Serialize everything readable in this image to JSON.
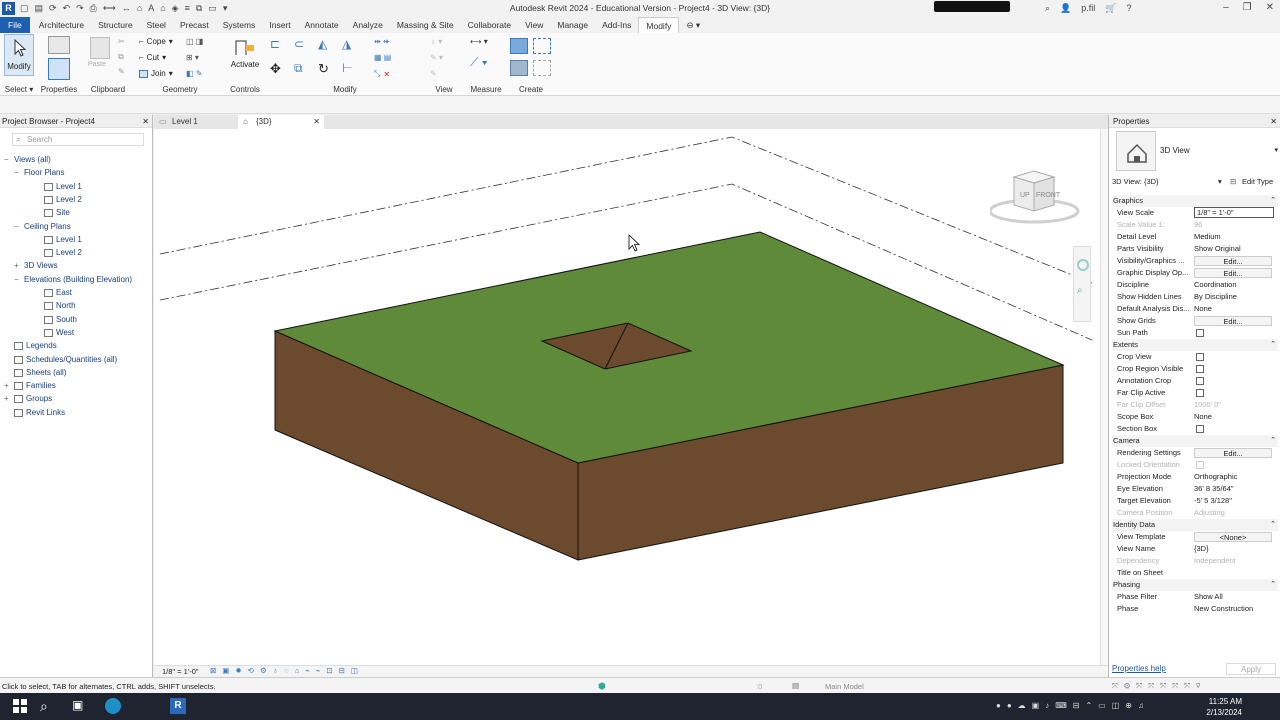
{
  "window": {
    "title": "Autodesk Revit 2024 - Educational Version - Project4 - 3D View: {3D}",
    "user": "p.fil"
  },
  "menu_tabs": [
    {
      "label": "File",
      "state": "file"
    },
    {
      "label": "Architecture"
    },
    {
      "label": "Structure"
    },
    {
      "label": "Steel"
    },
    {
      "label": "Precast"
    },
    {
      "label": "Systems"
    },
    {
      "label": "Insert"
    },
    {
      "label": "Annotate"
    },
    {
      "label": "Analyze"
    },
    {
      "label": "Massing & Site"
    },
    {
      "label": "Collaborate"
    },
    {
      "label": "View"
    },
    {
      "label": "Manage"
    },
    {
      "label": "Add-Ins"
    },
    {
      "label": "Modify",
      "state": "active"
    }
  ],
  "ribbon": {
    "modify_label": "Modify",
    "panels": {
      "select": "Select",
      "properties": "Properties",
      "clipboard": "Clipboard",
      "geometry": "Geometry",
      "controls": "Controls",
      "modify": "Modify",
      "view": "View",
      "measure": "Measure",
      "create": "Create"
    },
    "paste_label": "Paste",
    "cope_label": "Cope",
    "cut_label": "Cut",
    "join_label": "Join",
    "activate_label": "Activate"
  },
  "project_browser": {
    "title": "Project Browser - Project4",
    "search_placeholder": "Search",
    "items": [
      {
        "label": "Views (all)",
        "level": 0,
        "toggle": "−"
      },
      {
        "label": "Floor Plans",
        "level": 1,
        "toggle": "−"
      },
      {
        "label": "Level 1",
        "level": 2,
        "toggle": ""
      },
      {
        "label": "Level 2",
        "level": 2,
        "toggle": ""
      },
      {
        "label": "Site",
        "level": 2,
        "toggle": ""
      },
      {
        "label": "Ceiling Plans",
        "level": 1,
        "toggle": "−"
      },
      {
        "label": "Level 1",
        "level": 2,
        "toggle": ""
      },
      {
        "label": "Level 2",
        "level": 2,
        "toggle": ""
      },
      {
        "label": "3D Views",
        "level": 1,
        "toggle": "+"
      },
      {
        "label": "Elevations (Building Elevation)",
        "level": 1,
        "toggle": "−"
      },
      {
        "label": "East",
        "level": 2,
        "toggle": ""
      },
      {
        "label": "North",
        "level": 2,
        "toggle": ""
      },
      {
        "label": "South",
        "level": 2,
        "toggle": ""
      },
      {
        "label": "West",
        "level": 2,
        "toggle": ""
      },
      {
        "label": "Legends",
        "level": 0,
        "toggle": ""
      },
      {
        "label": "Schedules/Quantities (all)",
        "level": 0,
        "toggle": ""
      },
      {
        "label": "Sheets (all)",
        "level": 0,
        "toggle": ""
      },
      {
        "label": "Families",
        "level": 0,
        "toggle": "+"
      },
      {
        "label": "Groups",
        "level": 0,
        "toggle": "+"
      },
      {
        "label": "Revit Links",
        "level": 0,
        "toggle": ""
      }
    ]
  },
  "doc_tabs": [
    {
      "label": "Level 1",
      "active": false
    },
    {
      "label": "{3D}",
      "active": true
    }
  ],
  "viewcube": {
    "top": "UP",
    "front": "FRONT"
  },
  "view_control": {
    "scale": "1/8\" = 1'-0\""
  },
  "properties": {
    "title": "Properties",
    "type_name": "3D View",
    "selector": "3D View: {3D}",
    "edit_type": "Edit Type",
    "rows": [
      {
        "kind": "cat",
        "k": "Graphics"
      },
      {
        "kind": "input",
        "k": "View Scale",
        "v": "1/8\" = 1'-0\""
      },
      {
        "kind": "dis",
        "k": "Scale Value   1:",
        "v": "96"
      },
      {
        "kind": "val",
        "k": "Detail Level",
        "v": "Medium"
      },
      {
        "kind": "val",
        "k": "Parts Visibility",
        "v": "Show Original"
      },
      {
        "kind": "edit",
        "k": "Visibility/Graphics ...",
        "v": "Edit..."
      },
      {
        "kind": "edit",
        "k": "Graphic Display Op...",
        "v": "Edit..."
      },
      {
        "kind": "val",
        "k": "Discipline",
        "v": "Coordination"
      },
      {
        "kind": "val",
        "k": "Show Hidden Lines",
        "v": "By Discipline"
      },
      {
        "kind": "val",
        "k": "Default Analysis Dis...",
        "v": "None"
      },
      {
        "kind": "edit",
        "k": "Show Grids",
        "v": "Edit..."
      },
      {
        "kind": "chk",
        "k": "Sun Path"
      },
      {
        "kind": "cat",
        "k": "Extents"
      },
      {
        "kind": "chk",
        "k": "Crop View"
      },
      {
        "kind": "chk",
        "k": "Crop Region Visible"
      },
      {
        "kind": "chk",
        "k": "Annotation Crop"
      },
      {
        "kind": "chk",
        "k": "Far Clip Active"
      },
      {
        "kind": "dis",
        "k": "Far Clip Offset",
        "v": "1000'  0\""
      },
      {
        "kind": "val",
        "k": "Scope Box",
        "v": "None"
      },
      {
        "kind": "chk",
        "k": "Section Box"
      },
      {
        "kind": "cat",
        "k": "Camera"
      },
      {
        "kind": "edit",
        "k": "Rendering Settings",
        "v": "Edit..."
      },
      {
        "kind": "dischk",
        "k": "Locked Orientation"
      },
      {
        "kind": "val",
        "k": "Projection Mode",
        "v": "Orthographic"
      },
      {
        "kind": "val",
        "k": "Eye Elevation",
        "v": "36'  8 35/64\""
      },
      {
        "kind": "val",
        "k": "Target Elevation",
        "v": "-5'  5 3/128\""
      },
      {
        "kind": "dis",
        "k": "Camera Position",
        "v": "Adjusting"
      },
      {
        "kind": "cat",
        "k": "Identity Data"
      },
      {
        "kind": "edit",
        "k": "View Template",
        "v": "<None>"
      },
      {
        "kind": "val",
        "k": "View Name",
        "v": "{3D}"
      },
      {
        "kind": "dis",
        "k": "Dependency",
        "v": "Independent"
      },
      {
        "kind": "val",
        "k": "Title on Sheet",
        "v": ""
      },
      {
        "kind": "cat",
        "k": "Phasing"
      },
      {
        "kind": "val",
        "k": "Phase Filter",
        "v": "Show All"
      },
      {
        "kind": "val",
        "k": "Phase",
        "v": "New Construction"
      }
    ],
    "help": "Properties help",
    "apply": "Apply"
  },
  "status": {
    "message": "Click to select, TAB for alternates, CTRL adds, SHIFT unselects.",
    "worksets": ":0",
    "model": "Main Model"
  },
  "taskbar": {
    "time": "11:25 AM",
    "date": "2/13/2024"
  },
  "colors": {
    "topsurface": "#5f8a3a",
    "soil": "#6b4a2e",
    "file_tab": "#1f5fb0"
  }
}
